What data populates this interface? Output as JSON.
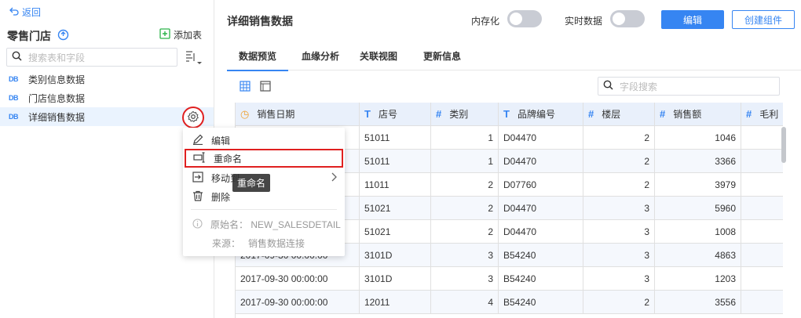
{
  "left": {
    "back_label": "返回",
    "store_title": "零售门店",
    "add_table_label": "添加表",
    "search_placeholder": "搜索表和字段",
    "tables": [
      {
        "icon": "DB",
        "label": "类别信息数据"
      },
      {
        "icon": "DB",
        "label": "门店信息数据"
      },
      {
        "icon": "DB",
        "label": "详细销售数据"
      }
    ]
  },
  "menu": {
    "items": [
      {
        "label": "编辑",
        "icon": "pencil-icon"
      },
      {
        "label": "重命名",
        "icon": "rename-icon"
      },
      {
        "label": "移动到",
        "icon": "move-icon"
      },
      {
        "label": "删除",
        "icon": "trash-icon"
      }
    ],
    "original_name_label": "原始名：",
    "original_name_value": "NEW_SALESDETAIL",
    "source_label": "来源：",
    "source_value": "销售数据连接",
    "tooltip": "重命名"
  },
  "header": {
    "title": "详细销售数据",
    "toggle1_label": "内存化",
    "toggle2_label": "实时数据",
    "edit_button": "编辑",
    "create_component_button": "创建组件"
  },
  "tabs": [
    "数据预览",
    "血缘分析",
    "关联视图",
    "更新信息"
  ],
  "field_search_placeholder": "字段搜索",
  "table": {
    "columns": [
      {
        "type": "clock",
        "type_glyph": "◷",
        "name": "销售日期"
      },
      {
        "type": "T",
        "type_glyph": "T",
        "name": "店号"
      },
      {
        "type": "#",
        "type_glyph": "#",
        "name": "类别"
      },
      {
        "type": "T",
        "type_glyph": "T",
        "name": "品牌编号"
      },
      {
        "type": "#",
        "type_glyph": "#",
        "name": "楼层"
      },
      {
        "type": "#",
        "type_glyph": "#",
        "name": "销售额"
      },
      {
        "type": "#",
        "type_glyph": "#",
        "name": "毛利"
      }
    ],
    "rows": [
      [
        "2017-09-30 00:00:00",
        "51011",
        "1",
        "D04470",
        "2",
        "1046",
        ""
      ],
      [
        "2017-09-30 00:00:00",
        "51011",
        "1",
        "D04470",
        "2",
        "3366",
        ""
      ],
      [
        "2017-09-30 00:00:00",
        "11011",
        "2",
        "D07760",
        "2",
        "3979",
        ""
      ],
      [
        "2017-09-30 00:00:00",
        "51021",
        "2",
        "D04470",
        "3",
        "5960",
        ""
      ],
      [
        "2017-09-30 00:00:00",
        "51021",
        "2",
        "D04470",
        "3",
        "1008",
        ""
      ],
      [
        "2017-09-30 00:00:00",
        "3101D",
        "3",
        "B54240",
        "3",
        "4863",
        ""
      ],
      [
        "2017-09-30 00:00:00",
        "3101D",
        "3",
        "B54240",
        "3",
        "1203",
        ""
      ],
      [
        "2017-09-30 00:00:00",
        "12011",
        "4",
        "B54240",
        "2",
        "3556",
        ""
      ]
    ]
  },
  "colors": {
    "accent": "#3685f2",
    "highlight": "#e02020"
  }
}
